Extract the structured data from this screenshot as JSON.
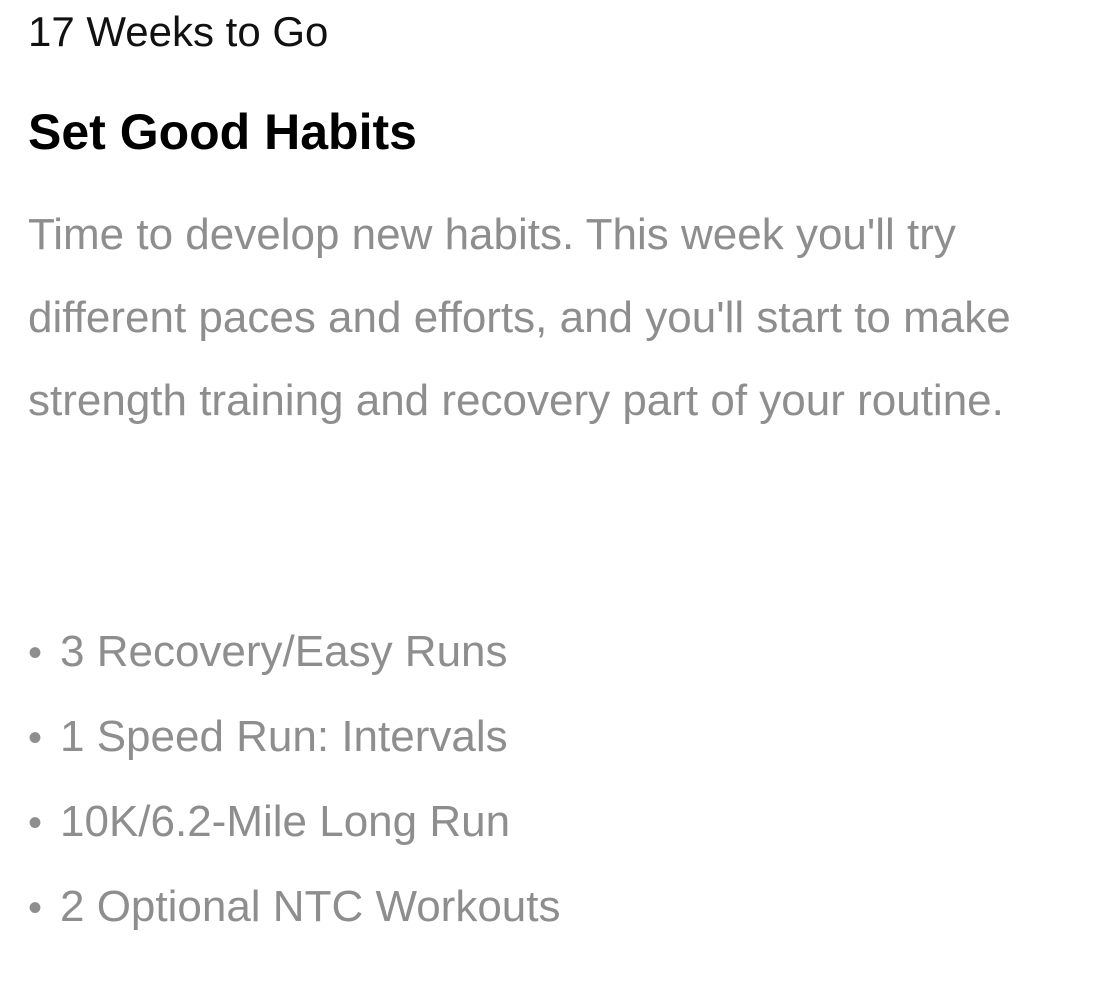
{
  "header": {
    "countdown": "17 Weeks to Go",
    "title": "Set Good Habits"
  },
  "description": "Time to develop new habits. This week you'll try different paces and efforts, and you'll start to make strength training and recovery part of your routine.",
  "workouts": [
    {
      "label": "3 Recovery/Easy Runs"
    },
    {
      "label": "1 Speed Run: Intervals"
    },
    {
      "label": "10K/6.2-Mile Long Run"
    },
    {
      "label": "2 Optional NTC Workouts"
    }
  ],
  "bullet_char": "•",
  "colors": {
    "primary_text": "#000000",
    "secondary_text": "#8e8e8e",
    "background": "#ffffff"
  }
}
